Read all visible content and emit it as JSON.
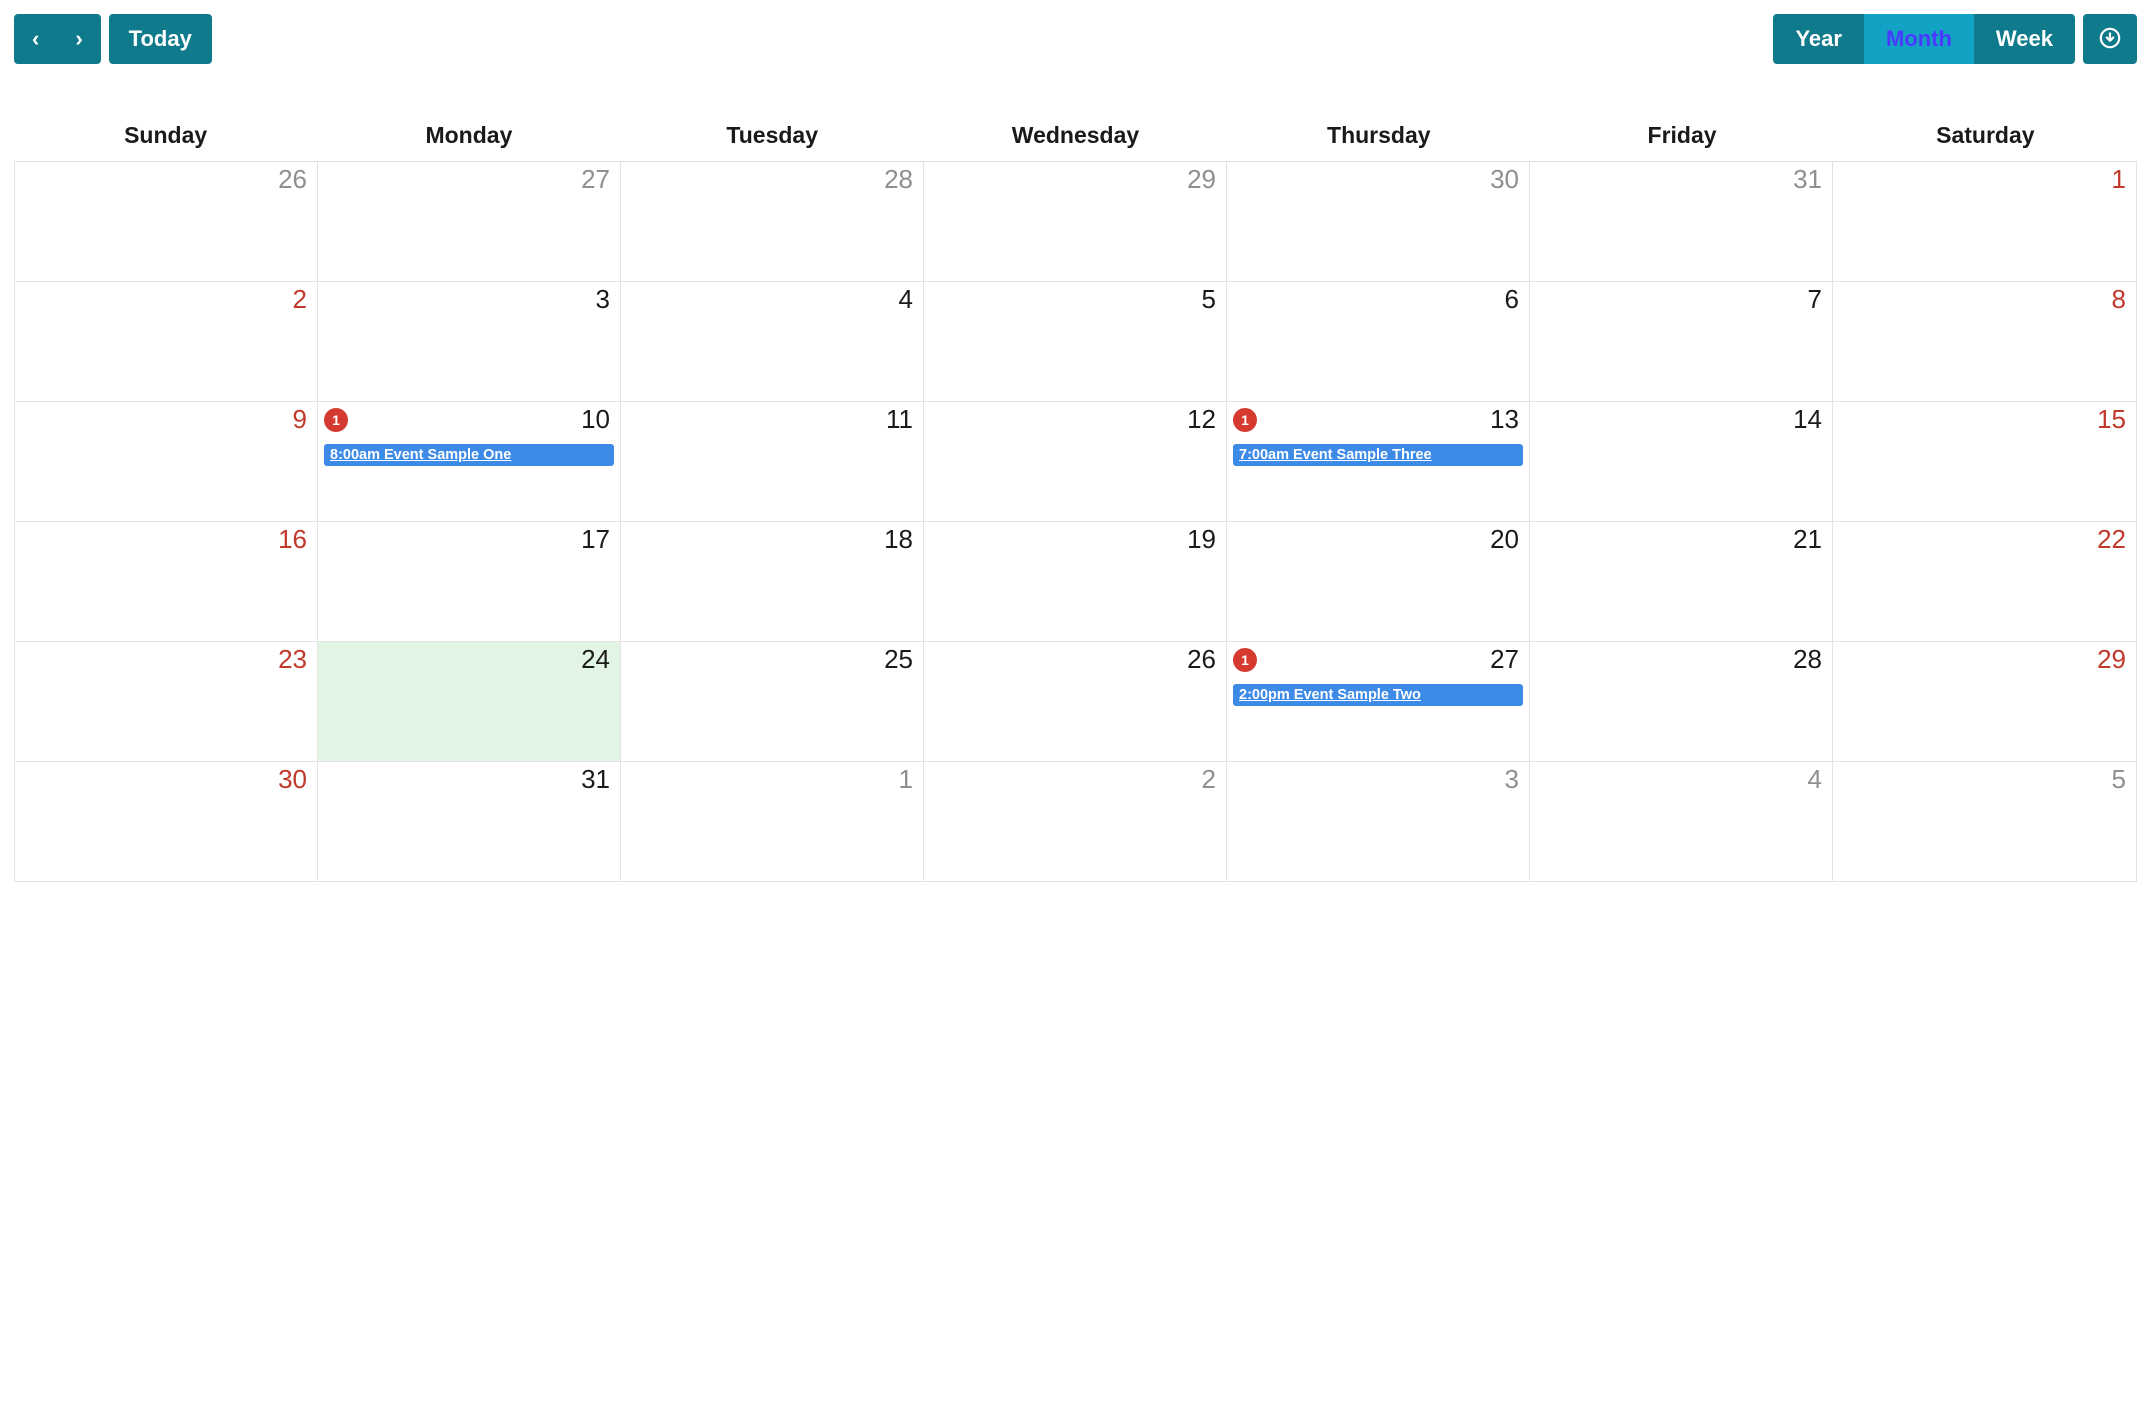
{
  "toolbar": {
    "prev": "‹",
    "next": "›",
    "today": "Today",
    "views": {
      "year": "Year",
      "month": "Month",
      "week": "Week",
      "active": "month"
    }
  },
  "weekdays": [
    "Sunday",
    "Monday",
    "Tuesday",
    "Wednesday",
    "Thursday",
    "Friday",
    "Saturday"
  ],
  "cells": [
    {
      "n": "26",
      "other": true
    },
    {
      "n": "27",
      "other": true
    },
    {
      "n": "28",
      "other": true
    },
    {
      "n": "29",
      "other": true
    },
    {
      "n": "30",
      "other": true
    },
    {
      "n": "31",
      "other": true
    },
    {
      "n": "1",
      "weekend": true
    },
    {
      "n": "2",
      "weekend": true
    },
    {
      "n": "3"
    },
    {
      "n": "4"
    },
    {
      "n": "5"
    },
    {
      "n": "6"
    },
    {
      "n": "7"
    },
    {
      "n": "8",
      "weekend": true
    },
    {
      "n": "9",
      "weekend": true
    },
    {
      "n": "10",
      "badge": "1",
      "events": [
        {
          "time": "8:00am",
          "title": "Event Sample One"
        }
      ]
    },
    {
      "n": "11"
    },
    {
      "n": "12"
    },
    {
      "n": "13",
      "badge": "1",
      "events": [
        {
          "time": "7:00am",
          "title": "Event Sample Three"
        }
      ]
    },
    {
      "n": "14"
    },
    {
      "n": "15",
      "weekend": true
    },
    {
      "n": "16",
      "weekend": true
    },
    {
      "n": "17"
    },
    {
      "n": "18"
    },
    {
      "n": "19"
    },
    {
      "n": "20"
    },
    {
      "n": "21"
    },
    {
      "n": "22",
      "weekend": true
    },
    {
      "n": "23",
      "weekend": true
    },
    {
      "n": "24",
      "today": true
    },
    {
      "n": "25"
    },
    {
      "n": "26"
    },
    {
      "n": "27",
      "badge": "1",
      "events": [
        {
          "time": "2:00pm",
          "title": "Event Sample Two"
        }
      ]
    },
    {
      "n": "28"
    },
    {
      "n": "29",
      "weekend": true
    },
    {
      "n": "30",
      "weekend": true
    },
    {
      "n": "31"
    },
    {
      "n": "1",
      "other": true
    },
    {
      "n": "2",
      "other": true
    },
    {
      "n": "3",
      "other": true
    },
    {
      "n": "4",
      "other": true
    },
    {
      "n": "5",
      "other": true
    }
  ]
}
